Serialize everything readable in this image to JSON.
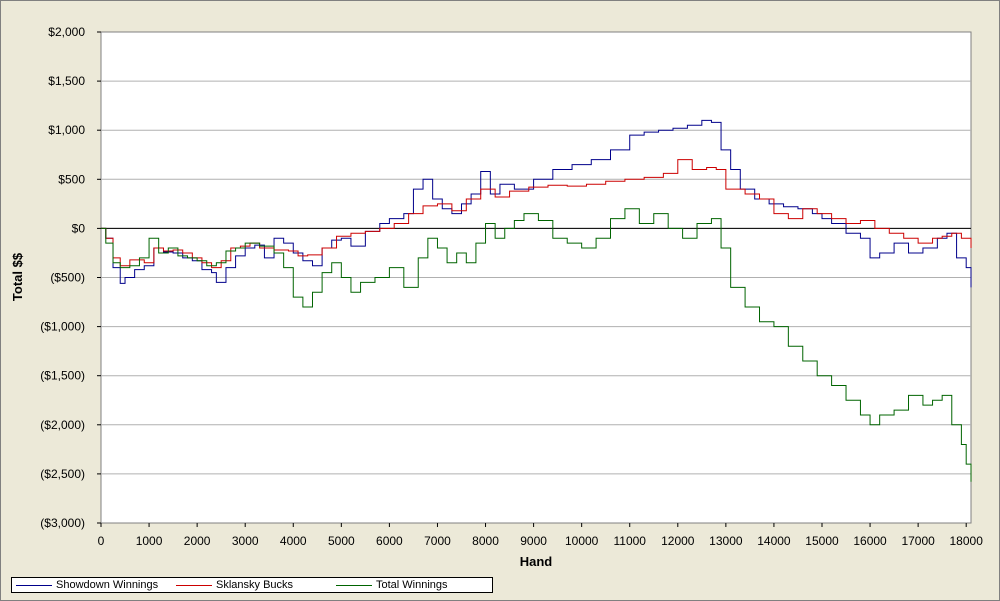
{
  "chart_data": {
    "type": "line",
    "xlabel": "Hand",
    "ylabel": "Total $$",
    "xlim": [
      0,
      18100
    ],
    "ylim": [
      -3000,
      2000
    ],
    "x_ticks": [
      0,
      1000,
      2000,
      3000,
      4000,
      5000,
      6000,
      7000,
      8000,
      9000,
      10000,
      11000,
      12000,
      13000,
      14000,
      15000,
      16000,
      17000,
      18000
    ],
    "x_tick_labels": [
      "0",
      "1000",
      "2000",
      "3000",
      "4000",
      "5000",
      "6000",
      "7000",
      "8000",
      "9000",
      "10000",
      "11000",
      "12000",
      "13000",
      "14000",
      "15000",
      "16000",
      "17000",
      "18000"
    ],
    "y_ticks": [
      2000,
      1500,
      1000,
      500,
      0,
      -500,
      -1000,
      -1500,
      -2000,
      -2500,
      -3000
    ],
    "y_tick_labels": [
      "$2,000",
      "$1,500",
      "$1,000",
      "$500",
      "$0",
      "($500)",
      "($1,000)",
      "($1,500)",
      "($2,000)",
      "($2,500)",
      "($3,000)"
    ],
    "grid": "horizontal",
    "legend_position": "bottom-left",
    "series": [
      {
        "name": "Showdown Winnings",
        "color": "#00008b",
        "x": [
          0,
          100,
          250,
          400,
          500,
          700,
          900,
          1100,
          1300,
          1500,
          1700,
          1900,
          2100,
          2300,
          2400,
          2600,
          2800,
          3000,
          3200,
          3400,
          3600,
          3800,
          4000,
          4200,
          4400,
          4600,
          4800,
          5000,
          5200,
          5500,
          5800,
          6000,
          6300,
          6500,
          6700,
          6900,
          7100,
          7300,
          7500,
          7700,
          7900,
          8100,
          8300,
          8600,
          9000,
          9400,
          9800,
          10200,
          10600,
          11000,
          11300,
          11600,
          11900,
          12200,
          12500,
          12700,
          12900,
          13100,
          13300,
          13600,
          13900,
          14200,
          14500,
          14800,
          15000,
          15200,
          15500,
          15800,
          16000,
          16200,
          16500,
          16800,
          17100,
          17400,
          17600,
          17800,
          18000,
          18100
        ],
        "y": [
          0,
          -100,
          -400,
          -560,
          -500,
          -420,
          -380,
          -200,
          -240,
          -250,
          -300,
          -330,
          -420,
          -450,
          -550,
          -400,
          -280,
          -200,
          -170,
          -300,
          -100,
          -150,
          -250,
          -330,
          -380,
          -200,
          -120,
          -100,
          -180,
          -30,
          50,
          100,
          150,
          400,
          500,
          300,
          200,
          150,
          250,
          350,
          580,
          350,
          450,
          400,
          500,
          600,
          650,
          700,
          800,
          950,
          980,
          1000,
          1020,
          1050,
          1100,
          1080,
          800,
          600,
          400,
          300,
          250,
          220,
          200,
          150,
          100,
          50,
          -50,
          -100,
          -300,
          -250,
          -150,
          -250,
          -200,
          -100,
          -50,
          -300,
          -400,
          -600
        ]
      },
      {
        "name": "Sklansky Bucks",
        "color": "#cc0000",
        "x": [
          0,
          100,
          250,
          400,
          600,
          900,
          1100,
          1300,
          1500,
          1700,
          1900,
          2100,
          2300,
          2500,
          2700,
          2900,
          3100,
          3300,
          3600,
          3900,
          4100,
          4300,
          4600,
          4900,
          5200,
          5500,
          5800,
          6100,
          6400,
          6700,
          7000,
          7300,
          7600,
          7900,
          8200,
          8500,
          8900,
          9300,
          9700,
          10100,
          10500,
          10900,
          11300,
          11700,
          12000,
          12300,
          12600,
          12800,
          13000,
          13200,
          13400,
          13700,
          14000,
          14300,
          14600,
          14900,
          15200,
          15500,
          15800,
          16100,
          16400,
          16700,
          17000,
          17300,
          17500,
          17700,
          17900,
          18100
        ],
        "y": [
          0,
          -100,
          -300,
          -380,
          -320,
          -350,
          -200,
          -230,
          -220,
          -250,
          -300,
          -350,
          -400,
          -330,
          -200,
          -180,
          -150,
          -200,
          -220,
          -230,
          -280,
          -270,
          -200,
          -80,
          -50,
          -30,
          0,
          50,
          150,
          230,
          250,
          180,
          300,
          400,
          320,
          380,
          420,
          440,
          430,
          450,
          480,
          500,
          520,
          560,
          700,
          600,
          620,
          600,
          400,
          400,
          350,
          300,
          150,
          100,
          200,
          150,
          100,
          50,
          80,
          0,
          -50,
          -100,
          -150,
          -100,
          -80,
          -50,
          -100,
          -200
        ]
      },
      {
        "name": "Total Winnings",
        "color": "#006400",
        "x": [
          0,
          100,
          250,
          400,
          600,
          800,
          1000,
          1200,
          1400,
          1600,
          1800,
          2000,
          2200,
          2400,
          2600,
          2800,
          3000,
          3300,
          3600,
          3800,
          4000,
          4200,
          4400,
          4600,
          4800,
          5000,
          5200,
          5400,
          5700,
          6000,
          6300,
          6600,
          6800,
          7000,
          7200,
          7400,
          7600,
          7800,
          8000,
          8200,
          8400,
          8600,
          8800,
          9100,
          9400,
          9700,
          10000,
          10300,
          10600,
          10900,
          11200,
          11500,
          11800,
          12100,
          12400,
          12700,
          12900,
          13100,
          13400,
          13700,
          14000,
          14300,
          14600,
          14900,
          15200,
          15500,
          15800,
          16000,
          16200,
          16500,
          16800,
          17100,
          17300,
          17500,
          17700,
          17900,
          18000,
          18100
        ],
        "y": [
          0,
          -150,
          -350,
          -400,
          -380,
          -300,
          -100,
          -250,
          -200,
          -280,
          -300,
          -330,
          -380,
          -350,
          -230,
          -200,
          -150,
          -180,
          -250,
          -400,
          -700,
          -800,
          -650,
          -450,
          -350,
          -500,
          -650,
          -550,
          -500,
          -400,
          -600,
          -300,
          -100,
          -200,
          -350,
          -250,
          -350,
          -150,
          50,
          -100,
          0,
          80,
          150,
          80,
          -100,
          -150,
          -200,
          -100,
          100,
          200,
          50,
          150,
          0,
          -100,
          50,
          100,
          -200,
          -600,
          -800,
          -950,
          -1000,
          -1200,
          -1350,
          -1500,
          -1600,
          -1750,
          -1900,
          -2000,
          -1900,
          -1850,
          -1700,
          -1800,
          -1750,
          -1700,
          -2000,
          -2200,
          -2400,
          -2580
        ]
      }
    ]
  }
}
